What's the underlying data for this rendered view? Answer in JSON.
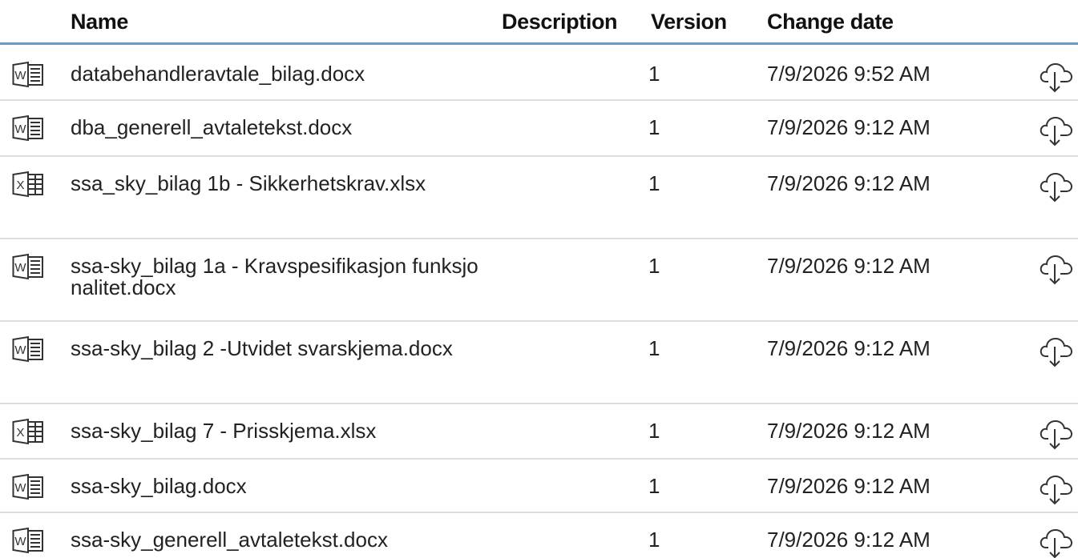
{
  "columns": {
    "name": "Name",
    "description": "Description",
    "version": "Version",
    "change_date": "Change date"
  },
  "rows": [
    {
      "icon": "word-icon",
      "name": "databehandleravtale_bilag.docx",
      "description": "",
      "version": "1",
      "date": "7/9/2026 9:52 AM"
    },
    {
      "icon": "word-icon",
      "name": "dba_generell_avtaletekst.docx",
      "description": "",
      "version": "1",
      "date": "7/9/2026 9:12 AM"
    },
    {
      "icon": "excel-icon",
      "name": "ssa_sky_bilag 1b - Sikkerhetskrav.xlsx",
      "description": "",
      "version": "1",
      "date": "7/9/2026 9:12 AM"
    },
    {
      "icon": "word-icon",
      "name": "ssa-sky_bilag 1a - Kravspesifikasjon funksjonalitet.docx",
      "description": "",
      "version": "1",
      "date": "7/9/2026 9:12 AM"
    },
    {
      "icon": "word-icon",
      "name": "ssa-sky_bilag 2 -Utvidet svarskjema.docx",
      "description": "",
      "version": "1",
      "date": "7/9/2026 9:12 AM"
    },
    {
      "icon": "excel-icon",
      "name": "ssa-sky_bilag 7 - Prisskjema.xlsx",
      "description": "",
      "version": "1",
      "date": "7/9/2026 9:12 AM"
    },
    {
      "icon": "word-icon",
      "name": "ssa-sky_bilag.docx",
      "description": "",
      "version": "1",
      "date": "7/9/2026 9:12 AM"
    },
    {
      "icon": "word-icon",
      "name": "ssa-sky_generell_avtaletekst.docx",
      "description": "",
      "version": "1",
      "date": "7/9/2026 9:12 AM"
    }
  ],
  "download_icon": "cloud-download-icon",
  "colors": {
    "header_rule": "#6a9cc8",
    "row_rule": "#dddddd"
  }
}
